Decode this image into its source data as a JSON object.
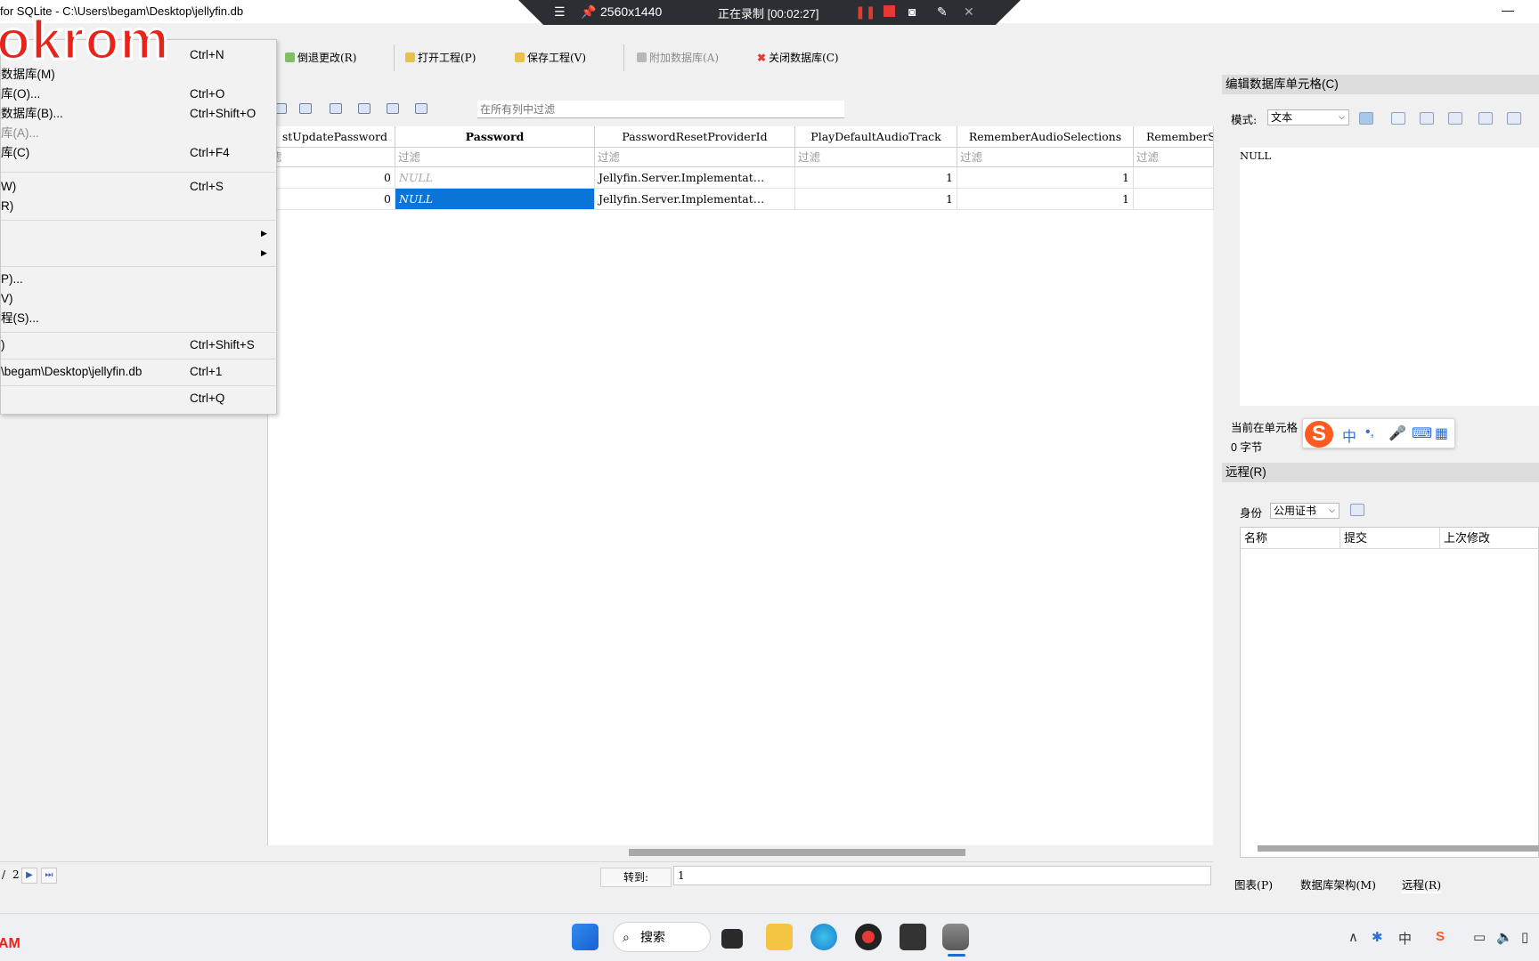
{
  "window": {
    "title": "for SQLite - C:\\Users\\begam\\Desktop\\jellyfin.db",
    "minimize": "—"
  },
  "recorder": {
    "resolution": "2560x1440",
    "status": "正在录制 [00:02:27]"
  },
  "toolbar": {
    "revert": "倒退更改(R)",
    "open_project": "打开工程(P)",
    "save_project": "保存工程(V)",
    "attach_db": "附加数据库(A)",
    "close_db": "关闭数据库(C)"
  },
  "filter": {
    "placeholder": "在所有列中过滤"
  },
  "grid": {
    "columns": [
      "stUpdatePassword",
      "Password",
      "PasswordResetProviderId",
      "PlayDefaultAudioTrack",
      "RememberAudioSelections",
      "RememberSu"
    ],
    "filter_label": "过滤",
    "first_filter": "滤",
    "rows": [
      [
        "0",
        "NULL",
        "Jellyfin.Server.Implementat…",
        "1",
        "1",
        ""
      ],
      [
        "0",
        "NULL",
        "Jellyfin.Server.Implementat…",
        "1",
        "1",
        ""
      ]
    ]
  },
  "status": {
    "page_sep": "/",
    "page_total": "2",
    "goto_label": "转到:",
    "goto_value": "1"
  },
  "editor": {
    "title": "编辑数据库单元格(C)",
    "mode_label": "模式:",
    "mode_value": "文本",
    "value": "NULL",
    "info_line1": "当前在单元格",
    "info_line2": "0 字节"
  },
  "remote": {
    "title": "远程(R)",
    "identity_label": "身份",
    "identity_value": "公用证书",
    "col_name": "名称",
    "col_commit": "提交",
    "col_modified": "上次修改"
  },
  "bottom_tabs": [
    "图表(P)",
    "数据库架构(M)",
    "远程(R)"
  ],
  "file_menu": {
    "items": [
      {
        "label": "",
        "shortcut": "Ctrl+N"
      },
      {
        "label": "数据库(M)",
        "shortcut": ""
      },
      {
        "label": "库(O)...",
        "shortcut": "Ctrl+O"
      },
      {
        "label": "数据库(B)...",
        "shortcut": "Ctrl+Shift+O"
      },
      {
        "label": "库(A)...",
        "shortcut": ""
      },
      {
        "label": "库(C)",
        "shortcut": "Ctrl+F4"
      },
      {
        "label": "W)",
        "shortcut": "Ctrl+S"
      },
      {
        "label": "R)",
        "shortcut": ""
      },
      {
        "label": "P)...",
        "shortcut": ""
      },
      {
        "label": "V)",
        "shortcut": ""
      },
      {
        "label": "程(S)...",
        "shortcut": ""
      },
      {
        "label": ")",
        "shortcut": "Ctrl+Shift+S"
      },
      {
        "label": "\\begam\\Desktop\\jellyfin.db",
        "shortcut": "Ctrl+1"
      },
      {
        "label": "",
        "shortcut": "Ctrl+Q"
      }
    ]
  },
  "watermark": {
    "text": "okrom",
    "corner": "AM"
  },
  "taskbar": {
    "search": "搜索",
    "ime_lang": "中"
  },
  "ime_bar": {
    "logo": "S",
    "lang": "中",
    "punct": "•,"
  },
  "colors": {
    "selection": "#0a74d8",
    "watermark": "#e8231a",
    "recorder_bg": "#2b2f33"
  }
}
